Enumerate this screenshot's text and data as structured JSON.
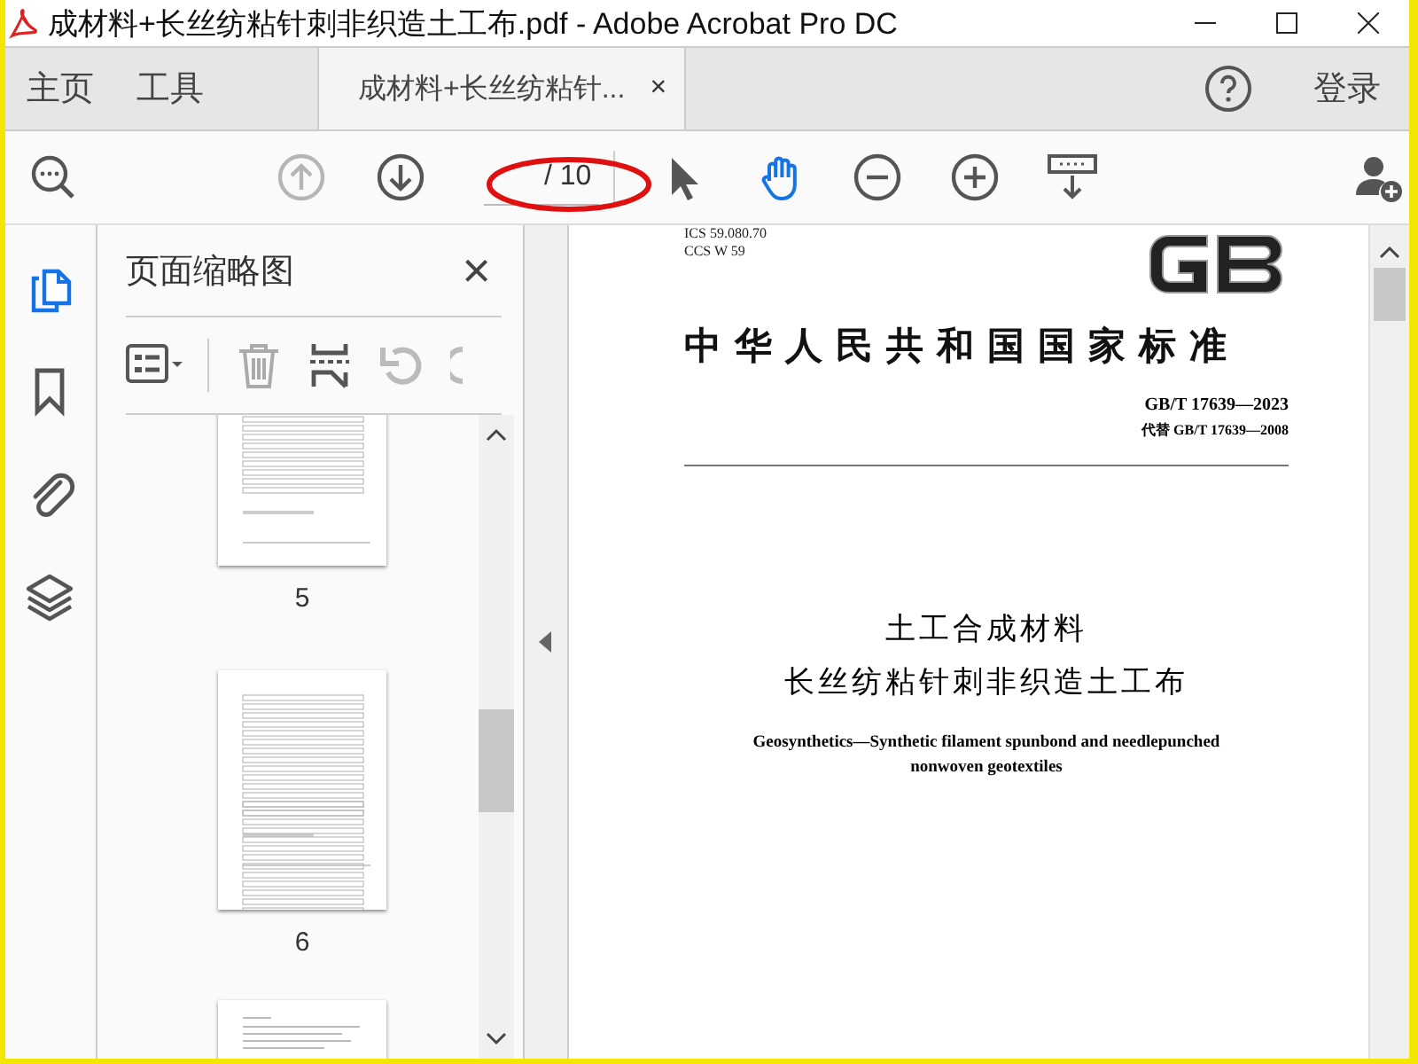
{
  "window": {
    "title": "成材料+长丝纺粘针刺非织造土工布.pdf - Adobe Acrobat Pro DC"
  },
  "nav_tabs": [
    {
      "label": "主页",
      "selected": false
    },
    {
      "label": "工具",
      "selected": false
    }
  ],
  "document_tab": {
    "label": "成材料+长丝纺粘针...",
    "close": "×",
    "selected": true
  },
  "account": {
    "sign_in": "登录"
  },
  "toolbar": {
    "tools": [
      {
        "selected": false,
        "disabled": false
      },
      {
        "selected": false,
        "disabled": true
      },
      {
        "selected": false,
        "disabled": false
      },
      {
        "selected": false,
        "disabled": false
      },
      {
        "selected": true,
        "disabled": false
      },
      {
        "selected": false,
        "disabled": false
      },
      {
        "selected": false,
        "disabled": false
      },
      {
        "selected": false,
        "disabled": false
      },
      {
        "selected": false,
        "disabled": false
      }
    ],
    "page_total": "/ 10"
  },
  "sidebar": {
    "items": [
      {
        "selected": true
      },
      {
        "selected": false
      },
      {
        "selected": false
      },
      {
        "selected": false
      }
    ]
  },
  "thumbnail_panel": {
    "title": "页面缩略图",
    "close": "×",
    "thumbnails": [
      {
        "label": "5"
      },
      {
        "label": "6"
      }
    ]
  },
  "document": {
    "ics": "ICS 59.080.70",
    "ccs": "CCS W 59",
    "heading": "中华人民共和国国家标准",
    "standard_number": "GB/T 17639—2023",
    "replaces": "代替 GB/T 17639—2008",
    "title_lines": [
      "土工合成材料",
      "长丝纺粘针刺非织造土工布"
    ],
    "english_title_lines": [
      "Geosynthetics—Synthetic filament spunbond and needlepunched",
      "nonwoven geotextiles"
    ]
  }
}
